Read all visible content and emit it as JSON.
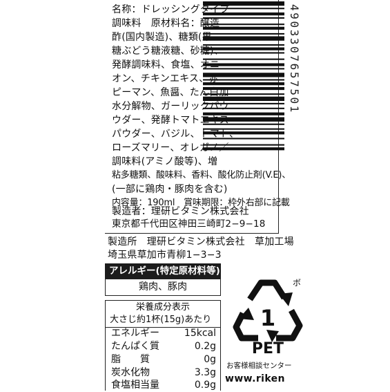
{
  "ingredients": {
    "lines": [
      "名称：ドレッシングタイプ",
      "調味料　原材料名：醸造",
      "酢(国内製造)、糖類(果",
      "糖ぶどう糖液糖、砂糖)、",
      "発酵調味料、食塩、オニ",
      "オン、チキンエキス、赤",
      "ピーマン、魚醤、たん白加",
      "水分解物、ガーリックパウ",
      "ウダー、発酵トマトエキス",
      "パウダー、バジル、トマト、",
      "ローズマリー、オレガノ／",
      "調味料(アミノ酸等)、増",
      "粘多糖類、酸味料、香料、酸化防止剤(V.E)、",
      "(一部に鶏肉・豚肉を含む)",
      "内容量：190ml　賞味期限：枠外右部に記載",
      "製造者：理研ビタミン株式会社",
      "東京都千代田区神田三崎町2−9−18"
    ]
  },
  "barcode": {
    "digits": "4903307657501"
  },
  "factory": {
    "line1": "製造所　理研ビタミン株式会社　草加工場",
    "line2": "埼玉県草加市青柳1−3−3"
  },
  "allergy": {
    "header": "アレルギー(特定原材料等)",
    "items": "鶏肉、豚肉"
  },
  "nutrition": {
    "title": "栄養成分表示",
    "serving": "大さじ約1杯(15g)あたり",
    "rows": [
      {
        "label": "エネルギー",
        "value": "15kcal"
      },
      {
        "label": "たんぱく質",
        "value": "0.2g"
      },
      {
        "label": "脂　　質",
        "value": "0g"
      },
      {
        "label": "炭水化物",
        "value": "3.3g"
      },
      {
        "label": "食塩相当量",
        "value": "0.9g"
      }
    ]
  },
  "recycle": {
    "number": "1",
    "code": "PET",
    "corner_text": "ボ"
  },
  "contact": {
    "text": "お客様相談センター",
    "url": "www.riken"
  }
}
